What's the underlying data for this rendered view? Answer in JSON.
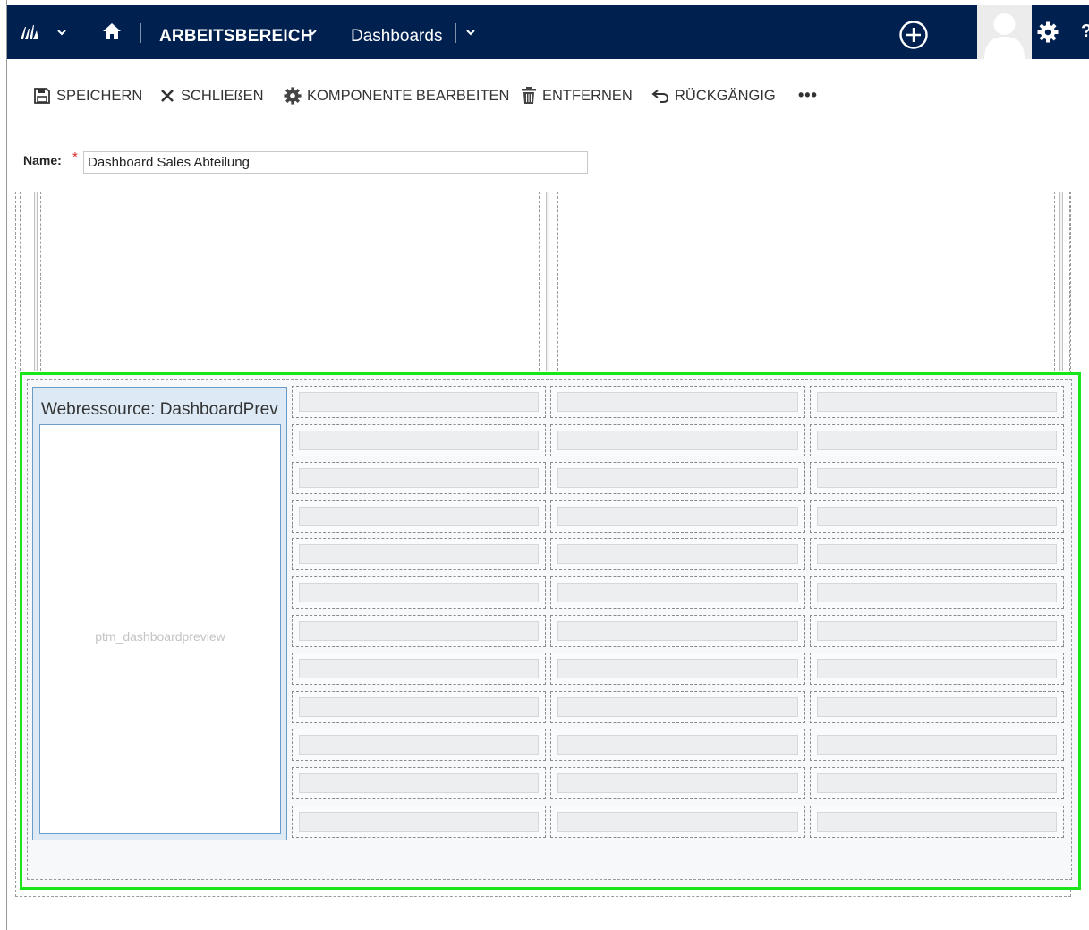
{
  "nav": {
    "area_label": "ARBEITSBEREICH",
    "section_label": "Dashboards",
    "help_glyph": "?"
  },
  "commands": {
    "save": "SPEICHERN",
    "close": "SCHLIEßEN",
    "edit_component": "KOMPONENTE BEARBEITEN",
    "remove": "ENTFERNEN",
    "undo": "RÜCKGÄNGIG",
    "more": "•••"
  },
  "form": {
    "name_label": "Name:",
    "required_marker": "*",
    "name_value": "Dashboard Sales Abteilung"
  },
  "webresource": {
    "title": "Webressource: DashboardPrev",
    "name": "ptm_dashboardpreview"
  },
  "grid": {
    "rows": 12,
    "columns": 3
  },
  "colors": {
    "nav_bg": "#002050",
    "selection": "#19e619",
    "webresource_border": "#6a9cc8",
    "required": "#d62b2b"
  },
  "icons": [
    "dynamics-logo-icon",
    "chevron-down-icon",
    "home-icon",
    "plus-circle-icon",
    "avatar-icon",
    "gear-icon",
    "save-icon",
    "close-icon",
    "gear-icon",
    "trash-icon",
    "undo-icon",
    "more-icon"
  ]
}
